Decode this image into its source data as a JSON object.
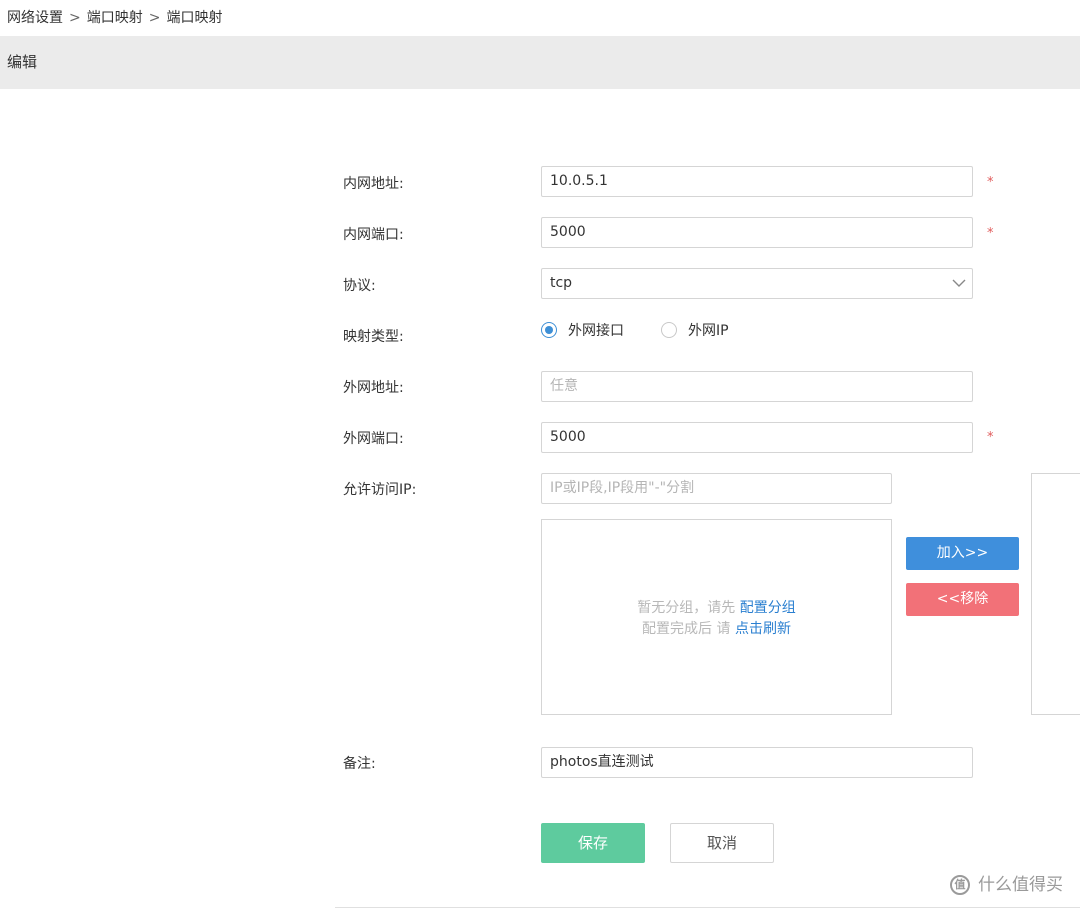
{
  "breadcrumb": {
    "items": [
      "网络设置",
      "端口映射",
      "端口映射"
    ],
    "separator": ">"
  },
  "header": {
    "title": "编辑"
  },
  "form": {
    "internal_address": {
      "label": "内网地址:",
      "value": "10.0.5.1",
      "required_mark": "*"
    },
    "internal_port": {
      "label": "内网端口:",
      "value": "5000",
      "required_mark": "*"
    },
    "protocol": {
      "label": "协议:",
      "selected": "tcp",
      "icon": "chevron-down-icon"
    },
    "mapping_type": {
      "label": "映射类型:",
      "options": [
        {
          "label": "外网接口",
          "checked": true
        },
        {
          "label": "外网IP",
          "checked": false
        }
      ]
    },
    "external_address": {
      "label": "外网地址:",
      "placeholder": "任意"
    },
    "external_port": {
      "label": "外网端口:",
      "value": "5000",
      "required_mark": "*"
    },
    "allowed_ip": {
      "label": "允许访问IP:",
      "placeholder": "IP或IP段,IP段用\"-\"分割",
      "empty_line1_text": "暂无分组，请先",
      "empty_line1_link": "配置分组",
      "empty_line2_text": "配置完成后 请",
      "empty_line2_link": "点击刷新",
      "add_button": "加入>>",
      "remove_button": "<<移除"
    },
    "remark": {
      "label": "备注:",
      "value": "photos直连测试"
    }
  },
  "actions": {
    "save": "保存",
    "cancel": "取消"
  },
  "watermark": {
    "text": "什么值得买",
    "icon_glyph": "值"
  },
  "colors": {
    "primary": "#3f8fdc",
    "danger": "#f27178",
    "success": "#5ecb9e",
    "required": "#e05a5a",
    "link": "#2a7fd0"
  }
}
